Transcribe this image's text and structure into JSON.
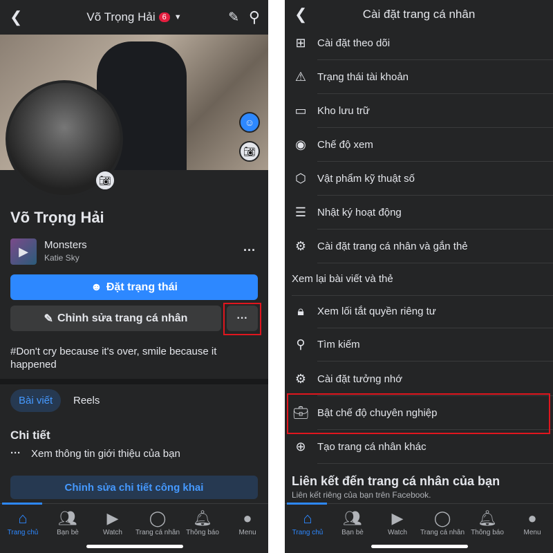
{
  "left": {
    "title": "Võ Trọng Hải",
    "badge": "6",
    "profile_name": "Võ Trọng Hải",
    "music": {
      "song": "Monsters",
      "artist": "Katie Sky"
    },
    "status_button": "Đặt trạng thái",
    "edit_button": "Chỉnh sửa trang cá nhân",
    "more": "···",
    "bio": "#Don't cry because it's over, smile because it happened",
    "tabs": [
      "Bài viết",
      "Reels"
    ],
    "details_heading": "Chi tiết",
    "details_link": "Xem thông tin giới thiệu của bạn",
    "edit_details_button": "Chỉnh sửa chi tiết công khai"
  },
  "right": {
    "title": "Cài đặt trang cá nhân",
    "items": [
      {
        "icon": "follow-settings-icon",
        "glyph": "⊞",
        "label": "Cài đặt theo dõi"
      },
      {
        "icon": "warning-icon",
        "glyph": "⚠",
        "label": "Trạng thái tài khoản"
      },
      {
        "icon": "archive-icon",
        "glyph": "▭",
        "label": "Kho lưu trữ"
      },
      {
        "icon": "eye-icon",
        "glyph": "◉",
        "label": "Chế độ xem"
      },
      {
        "icon": "digital-item-icon",
        "glyph": "⬡",
        "label": "Vật phẩm kỹ thuật số"
      },
      {
        "icon": "activity-log-icon",
        "glyph": "☰",
        "label": "Nhật ký hoạt động"
      },
      {
        "icon": "profile-tag-settings-icon",
        "glyph": "⚙",
        "label": "Cài đặt trang cá nhân và gắn thẻ"
      },
      {
        "icon": "",
        "glyph": "",
        "label": "Xem lại bài viết và thẻ"
      },
      {
        "icon": "lock-icon",
        "glyph": "🔒︎",
        "label": "Xem lối tắt quyền riêng tư"
      },
      {
        "icon": "search-icon",
        "glyph": "⚲",
        "label": "Tìm kiếm"
      },
      {
        "icon": "memorial-settings-icon",
        "glyph": "⚙",
        "label": "Cài đặt tưởng nhớ"
      },
      {
        "icon": "briefcase-icon",
        "glyph": "💼︎",
        "label": "Bật chế độ chuyên nghiệp"
      },
      {
        "icon": "plus-circle-icon",
        "glyph": "⊕",
        "label": "Tạo trang cá nhân khác"
      }
    ],
    "link_heading": "Liên kết đến trang cá nhân của bạn",
    "link_sub": "Liên kết riêng của bạn trên Facebook."
  },
  "nav": [
    {
      "icon": "home-icon",
      "glyph": "⌂",
      "label": "Trang chủ"
    },
    {
      "icon": "friends-icon",
      "glyph": "👥︎",
      "label": "Bạn bè"
    },
    {
      "icon": "watch-icon",
      "glyph": "▶",
      "label": "Watch"
    },
    {
      "icon": "profile-icon",
      "glyph": "◯",
      "label": "Trang cá nhân"
    },
    {
      "icon": "bell-icon",
      "glyph": "🔔︎",
      "label": "Thông báo"
    },
    {
      "icon": "menu-avatar-icon",
      "glyph": "●",
      "label": "Menu"
    }
  ],
  "colors": {
    "accent": "#2d88ff",
    "background": "#242526",
    "highlight": "#e0161e"
  }
}
